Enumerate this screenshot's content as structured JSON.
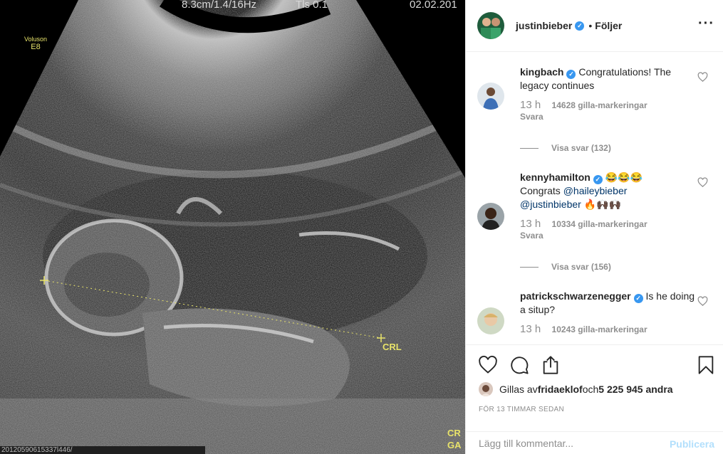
{
  "ultrasound": {
    "header_values": [
      "8.3cm/1.4/16Hz",
      "Tls 0.1",
      "02.02.201"
    ],
    "brand": "Voluson",
    "probe": "E8",
    "measure_label": "CRL",
    "corner_label": "CR\nGA",
    "file_label": "20120590615337l446/"
  },
  "header": {
    "username": "justinbieber",
    "separator": "•",
    "follow_state": "Följer",
    "more_label": "•••"
  },
  "comments": [
    {
      "username": "kingbach",
      "text": "Congratulations! The legacy continues",
      "time": "13 h",
      "likes": "14628 gilla-markeringar",
      "reply": "Svara",
      "view_replies": "Visa svar (132)"
    },
    {
      "username": "kennyhamilton",
      "text_prefix": "😂😂😂",
      "text_congrats": "Congrats ",
      "mention1": "@haileybieber",
      "mention2": "@justinbieber",
      "text_suffix": " 🔥🙌🏿🙌🏿",
      "time": "13 h",
      "likes": "10334 gilla-markeringar",
      "reply": "Svara",
      "view_replies": "Visa svar (156)"
    },
    {
      "username": "patrickschwarzenegger",
      "text": "Is he doing a situp?",
      "time": "13 h",
      "likes": "10243 gilla-markeringar"
    }
  ],
  "likes": {
    "prefix": "Gillas av ",
    "user": "fridaeklof",
    "middle": " och ",
    "count": "5 225 945 andra"
  },
  "time_ago": "FÖR 13 TIMMAR SEDAN",
  "comment_box": {
    "placeholder": "Lägg till kommentar...",
    "publish_label": "Publicera"
  },
  "colors": {
    "verified": "#3897f0",
    "mention": "#003569",
    "publish_disabled": "#b2dffc",
    "ultrasound_yellow": "#e8e36a"
  },
  "icons": [
    "heart-icon",
    "comment-icon",
    "share-icon",
    "bookmark-icon",
    "verified-badge-icon",
    "more-icon"
  ]
}
